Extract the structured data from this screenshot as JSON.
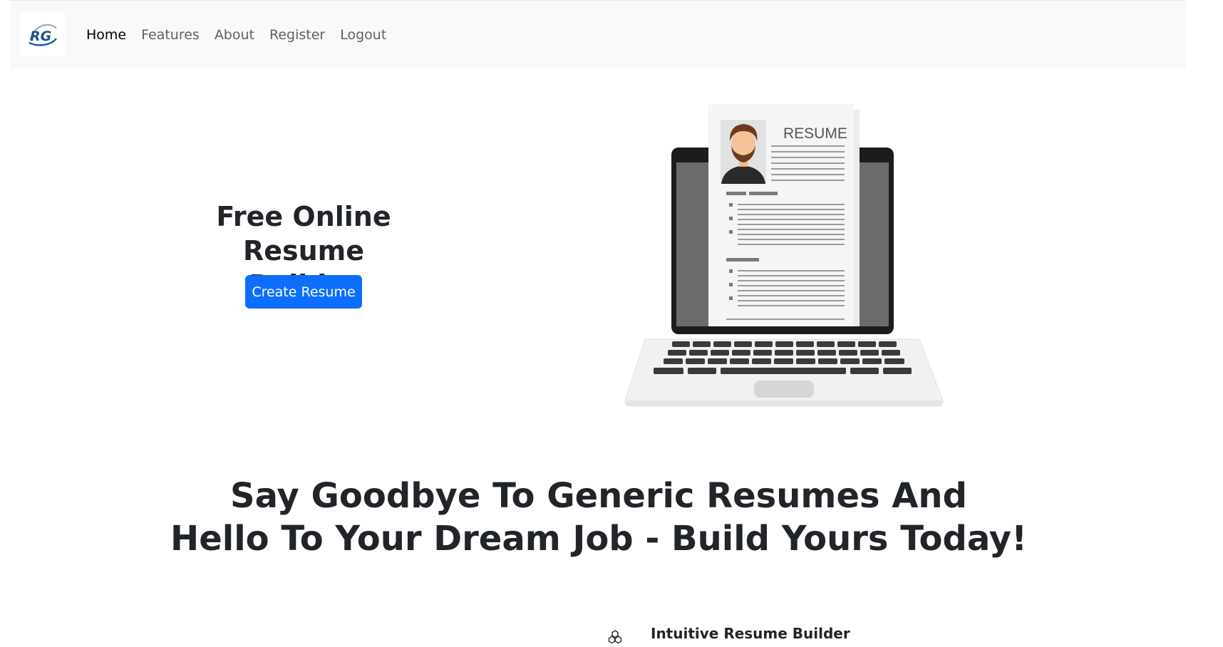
{
  "navbar": {
    "logo_text": "RG",
    "links": [
      {
        "label": "Home",
        "active": true
      },
      {
        "label": "Features",
        "active": false
      },
      {
        "label": "About",
        "active": false
      },
      {
        "label": "Register",
        "active": false
      },
      {
        "label": "Logout",
        "active": false
      }
    ]
  },
  "hero": {
    "title_line1": "Free Online Resume",
    "title_line2": "Builder",
    "button_label": "Create Resume",
    "illustration_label": "RESUME"
  },
  "tagline": {
    "line1": "Say Goodbye To Generic Resumes And",
    "line2": "Hello To Your Dream Job - Build Yours Today!"
  },
  "features": {
    "items": [
      {
        "icon": "cubes-icon",
        "title": "Intuitive Resume Builder"
      }
    ]
  },
  "colors": {
    "primary": "#0d6efd",
    "navbar_bg": "#f8f9fa",
    "text": "#212529"
  }
}
